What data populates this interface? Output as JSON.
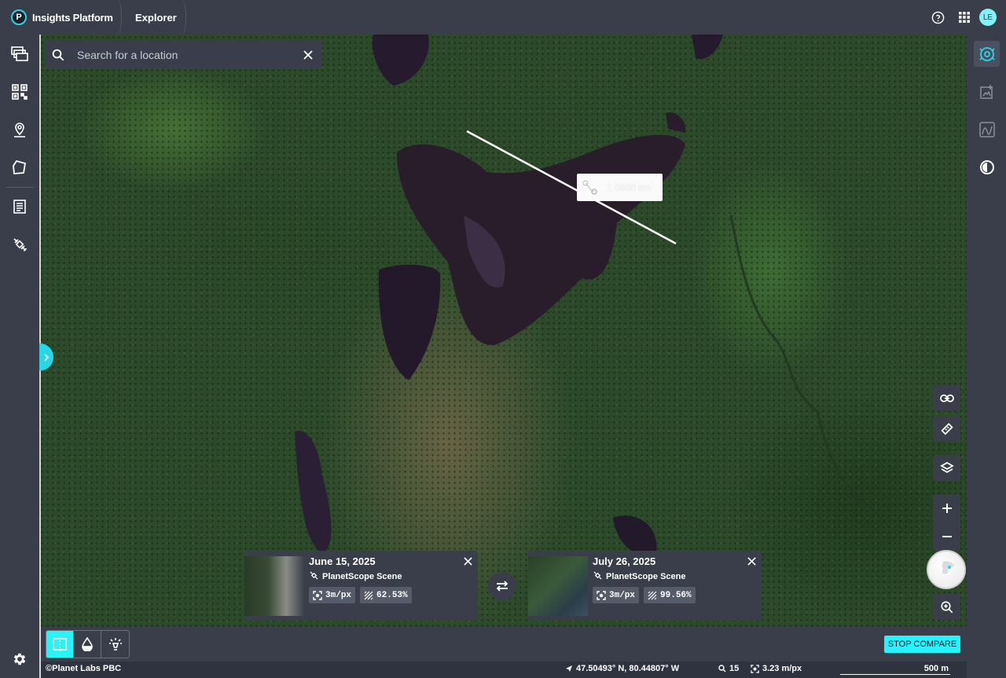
{
  "app": {
    "title": "Insights Platform",
    "logo_letter": "P"
  },
  "header": {
    "tab_label": "Explorer",
    "avatar_initials": "LE"
  },
  "icons": {
    "help": "help-circle-icon",
    "apps": "apps-grid-icon",
    "left_rail": [
      "layers-stack-icon",
      "qr-grid-icon",
      "location-pin-icon",
      "polygon-icon",
      "document-icon",
      "satellite-icon"
    ],
    "right_rail": [
      "radar-icon",
      "add-image-icon",
      "chart-area-icon",
      "contrast-icon"
    ]
  },
  "search": {
    "placeholder": "Search for a location",
    "value": ""
  },
  "measurement": {
    "distance": "1.0800 km"
  },
  "compare": {
    "left": {
      "date": "June 15, 2025",
      "type": "PlanetScope Scene",
      "resolution": "3m/px",
      "coverage": "62.53%"
    },
    "right": {
      "date": "July 26, 2025",
      "type": "PlanetScope Scene",
      "resolution": "3m/px",
      "coverage": "99.56%"
    }
  },
  "bottom": {
    "stop_compare": "STOP COMPARE"
  },
  "status": {
    "attribution": "©Planet Labs PBC",
    "coords": "47.50493° N, 80.44807° W",
    "zoom": "15",
    "pixel_size": "3.23 m/px",
    "scale": "500 m"
  },
  "colors": {
    "accent": "#2ad6e6",
    "panel": "#3a3e4b",
    "stop_button": "#23f4ff"
  }
}
